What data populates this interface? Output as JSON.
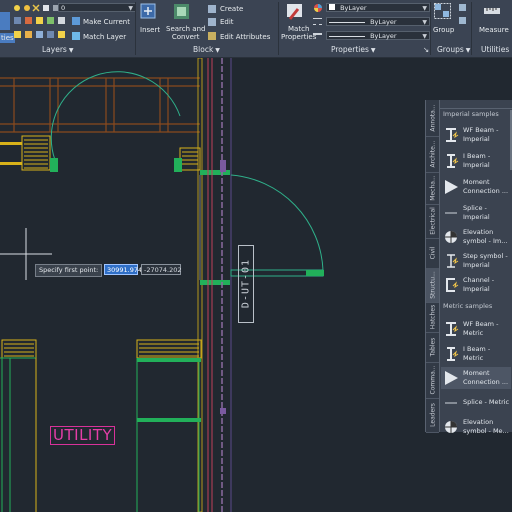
{
  "ribbon": {
    "properties_btn": "ties",
    "layer_combo_value": "0",
    "make_current": "Make Current",
    "match_layer": "Match Layer",
    "layers_panel": "Layers",
    "insert": "Insert",
    "search_convert": "Search and\nConvert",
    "create": "Create",
    "edit": "Edit",
    "edit_attributes": "Edit Attributes",
    "block_panel": "Block",
    "match_properties": "Match\nProperties",
    "color_value": "ByLayer",
    "linetype_value": "ByLayer",
    "lineweight_value": "ByLayer",
    "properties_panel": "Properties",
    "group": "Group",
    "groups_panel": "Groups",
    "measure": "Measure",
    "utilities_panel": "Utilities"
  },
  "drawing": {
    "prompt": "Specify first point:",
    "x_value": "30991.974",
    "y_value": "-27074.202",
    "room_label": "UTILITY",
    "door_tag": "D-UT-01"
  },
  "palette": {
    "tabs": [
      "Annota...",
      "Archite...",
      "Mecha...",
      "Electrical",
      "Civil",
      "Structu...",
      "Hatches",
      "Tables",
      "Comma...",
      "Leaders"
    ],
    "imperial_heading": "Imperial samples",
    "imperial_items": [
      {
        "label": "WF Beam -\nImperial",
        "icon": "wf-beam-icon"
      },
      {
        "label": "I Beam -\nImperial",
        "icon": "i-beam-icon"
      },
      {
        "label": "Moment\nConnection ...",
        "icon": "moment-icon"
      },
      {
        "label": "Splice -\nImperial",
        "icon": "splice-icon"
      },
      {
        "label": "Elevation\nsymbol - Im...",
        "icon": "elevation-icon"
      },
      {
        "label": "Step symbol -\nImperial",
        "icon": "step-icon"
      },
      {
        "label": "Channel -\nImperial",
        "icon": "channel-icon"
      }
    ],
    "metric_heading": "Metric samples",
    "metric_items": [
      {
        "label": "WF Beam -\nMetric",
        "icon": "wf-beam-icon"
      },
      {
        "label": "I Beam -\nMetric",
        "icon": "i-beam-icon"
      },
      {
        "label": "Moment\nConnection ...",
        "icon": "moment-icon"
      },
      {
        "label": "Splice - Metric",
        "icon": "splice-icon"
      },
      {
        "label": "Elevation\nsymbol - Me...",
        "icon": "elevation-icon"
      }
    ]
  }
}
